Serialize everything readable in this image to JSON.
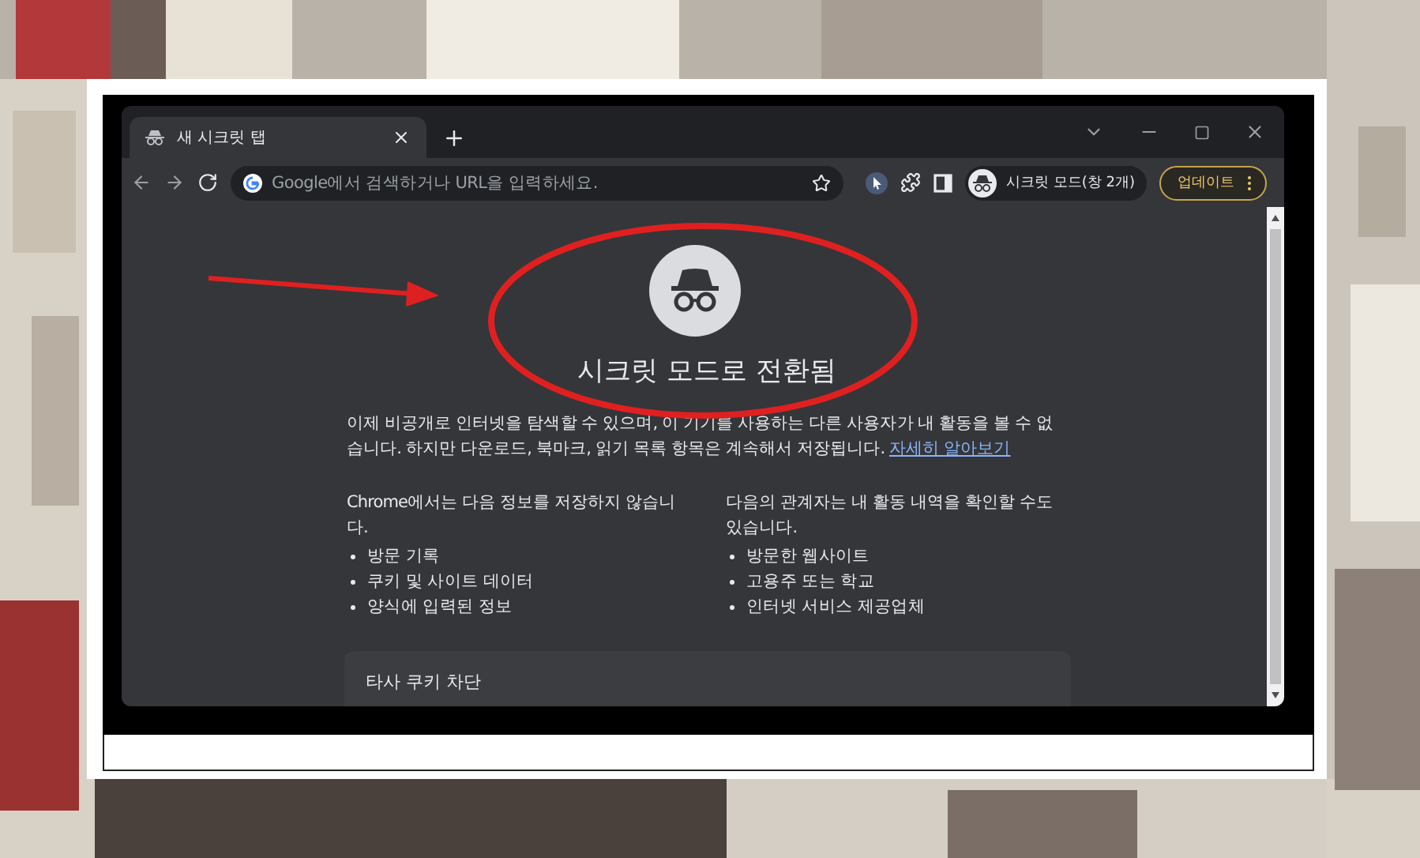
{
  "tabs": [
    {
      "title": "새 시크릿 탭",
      "selected": true
    }
  ],
  "address_bar": {
    "placeholder": "Google에서 검색하거나 URL을 입력하세요."
  },
  "profile": {
    "label": "시크릿 모드(창 2개)"
  },
  "update_button": {
    "label": "업데이트"
  },
  "page": {
    "title": "시크릿 모드로 전환됨",
    "intro": "이제 비공개로 인터넷을 탐색할 수 있으며, 이 기기를 사용하는 다른 사용자가 내 활동을 볼 수 없습니다. 하지만 다운로드, 북마크, 읽기 목록 항목은 계속해서 저장됩니다.",
    "learn_more_link": "자세히 알아보기",
    "columns": [
      {
        "heading": "Chrome에서는 다음 정보를 저장하지 않습니다.",
        "items": [
          "방문 기록",
          "쿠키 및 사이트 데이터",
          "양식에 입력된 정보"
        ]
      },
      {
        "heading": "다음의 관계자는 내 활동 내역을 확인할 수도 있습니다.",
        "items": [
          "방문한 웹사이트",
          "고용주 또는 학교",
          "인터넷 서비스 제공업체"
        ]
      }
    ],
    "card": {
      "title": "타사 쿠키 차단"
    }
  }
}
